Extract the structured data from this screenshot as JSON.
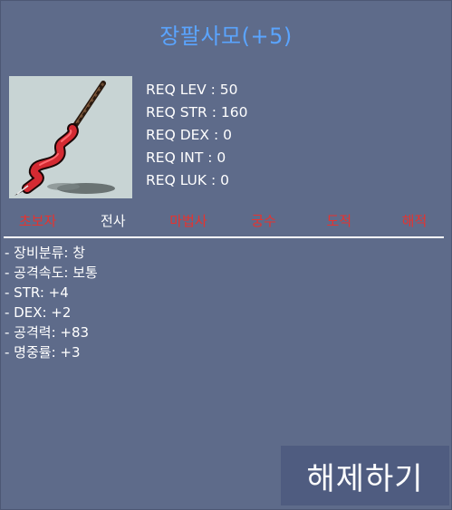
{
  "item": {
    "title": "장팔사모(+5)",
    "icon": "spear-icon"
  },
  "requirements": [
    "REQ LEV : 50",
    "REQ STR : 160",
    "REQ DEX : 0",
    "REQ INT : 0",
    "REQ LUK : 0"
  ],
  "jobs": [
    {
      "label": "초보자",
      "color": "#e8322e"
    },
    {
      "label": "전사",
      "color": "#ffffff"
    },
    {
      "label": "마법사",
      "color": "#e8322e"
    },
    {
      "label": "궁수",
      "color": "#e8322e"
    },
    {
      "label": "도적",
      "color": "#e8322e"
    },
    {
      "label": "해적",
      "color": "#e8322e"
    }
  ],
  "stats": [
    "- 장비분류: 창",
    "- 공격속도: 보통",
    "- STR: +4",
    "- DEX: +2",
    "- 공격력: +83",
    "- 명중률: +3"
  ],
  "actions": {
    "unequip_label": "해제하기"
  },
  "colors": {
    "background": "#5e6b8a",
    "title": "#5aa4ff",
    "job_restricted": "#e8322e",
    "button": "#4f5c80"
  }
}
